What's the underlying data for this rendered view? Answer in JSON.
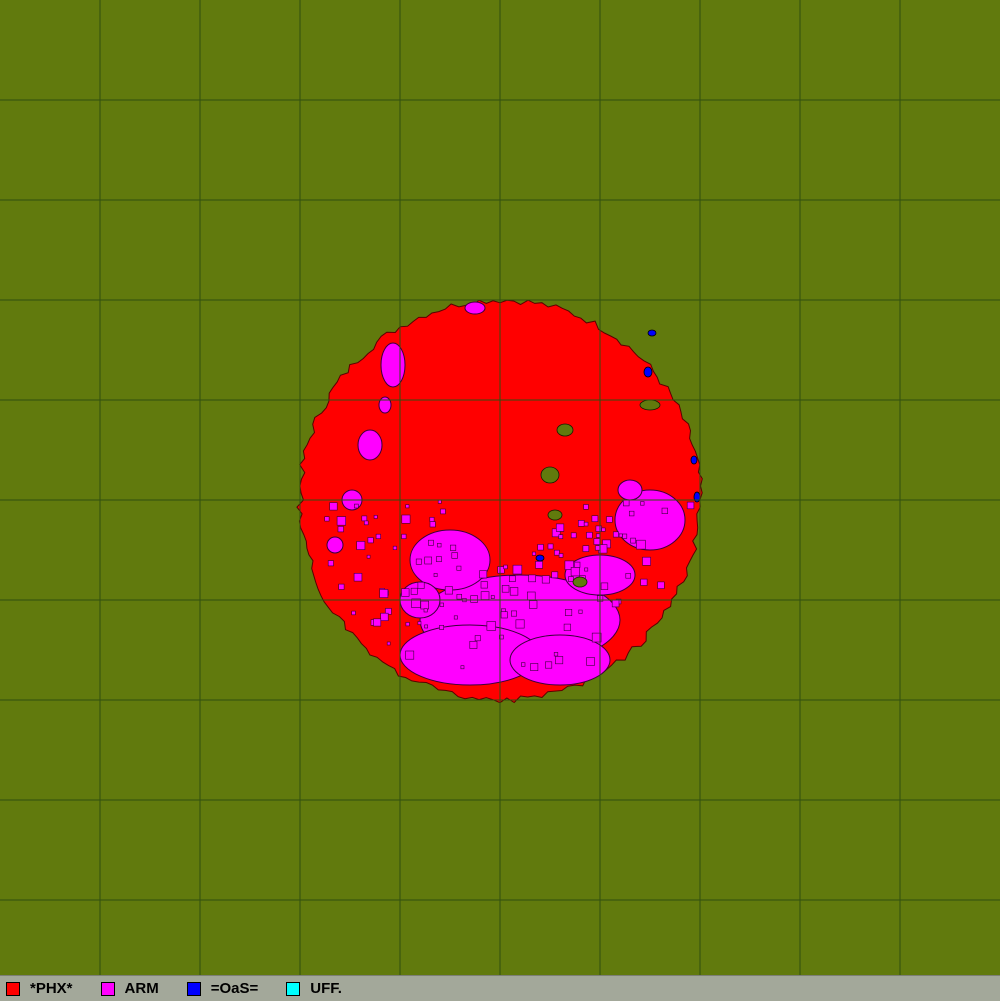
{
  "map": {
    "background_color": "#617a0d",
    "grid_color": "#2f4f10",
    "territory": {
      "primary_color": "#ff0000",
      "secondary_color": "#ff00ff",
      "minor_color": "#0000ff",
      "hole_color": "#617a0d"
    }
  },
  "legend": {
    "items": [
      {
        "label": "*PHX*",
        "color": "#ff0000"
      },
      {
        "label": "ARM",
        "color": "#ff00ff"
      },
      {
        "label": "=OaS=",
        "color": "#0000ff"
      },
      {
        "label": "UFF.",
        "color": "#00ffff"
      }
    ]
  }
}
